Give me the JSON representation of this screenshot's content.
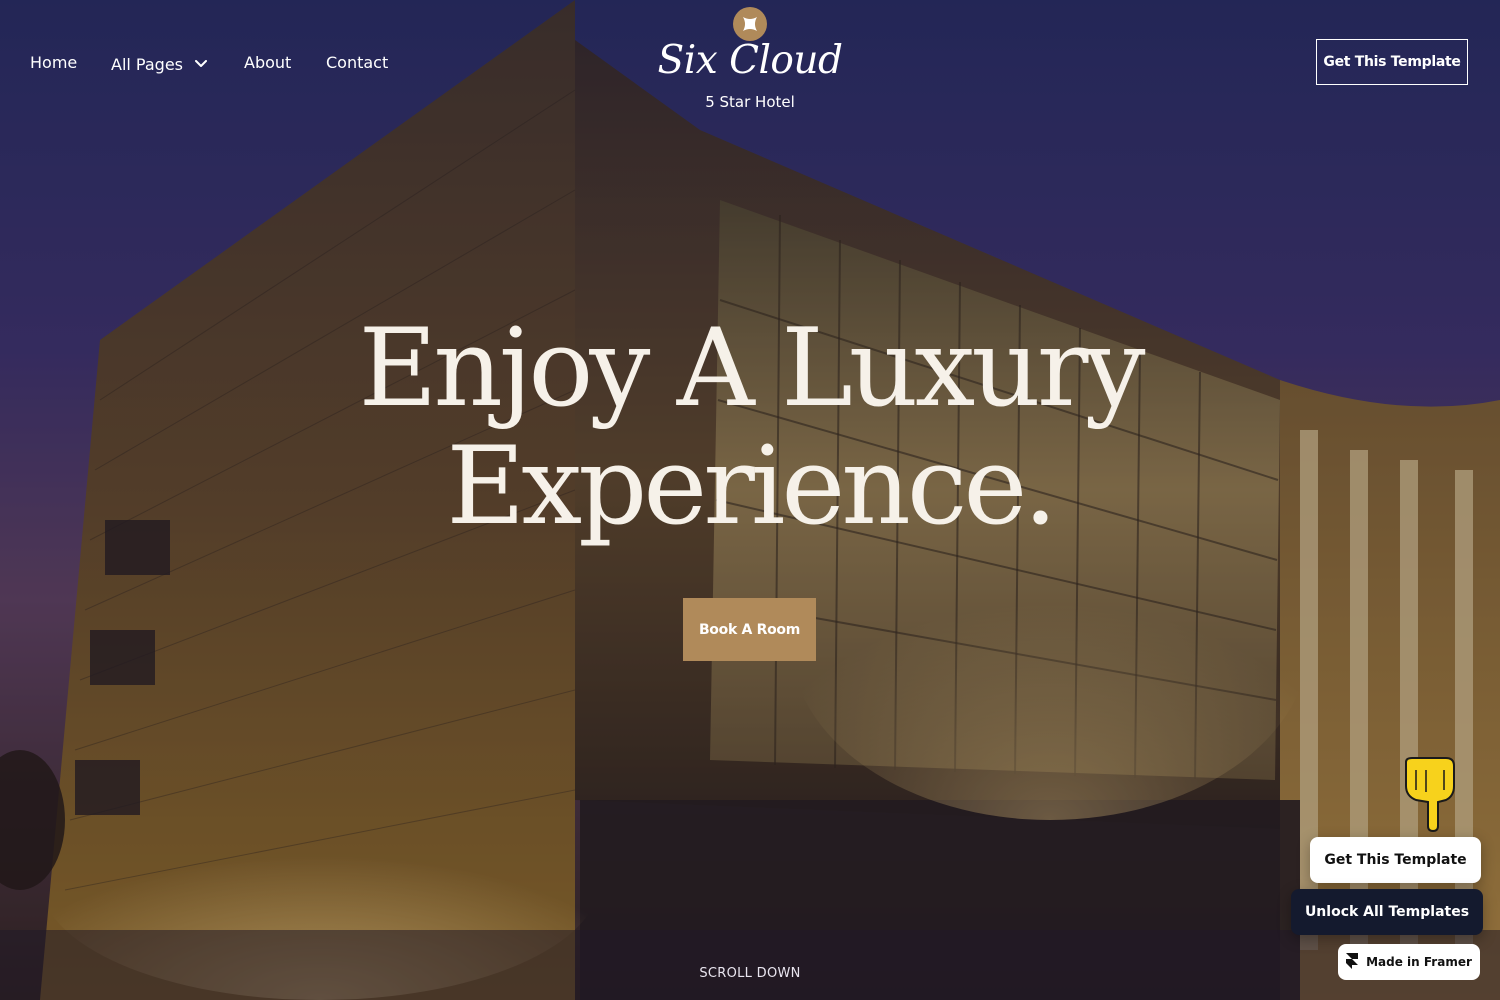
{
  "nav": {
    "links": [
      {
        "label": "Home"
      },
      {
        "label": "All Pages"
      },
      {
        "label": "About"
      },
      {
        "label": "Contact"
      }
    ],
    "cta_label": "Get This Template"
  },
  "brand": {
    "name": "Six Cloud",
    "tagline": "5 Star Hotel",
    "accent_color": "#b08a5a"
  },
  "hero": {
    "headline_line1": "Enjoy A Luxury",
    "headline_line2": "Experience.",
    "button_label": "Book A Room",
    "scroll_label": "SCROLL DOWN"
  },
  "floating": {
    "get_template_label": "Get This Template",
    "unlock_label": "Unlock All Templates",
    "framer_badge_label": "Made in Framer",
    "pointer_icon": "pointing-hand-icon"
  }
}
